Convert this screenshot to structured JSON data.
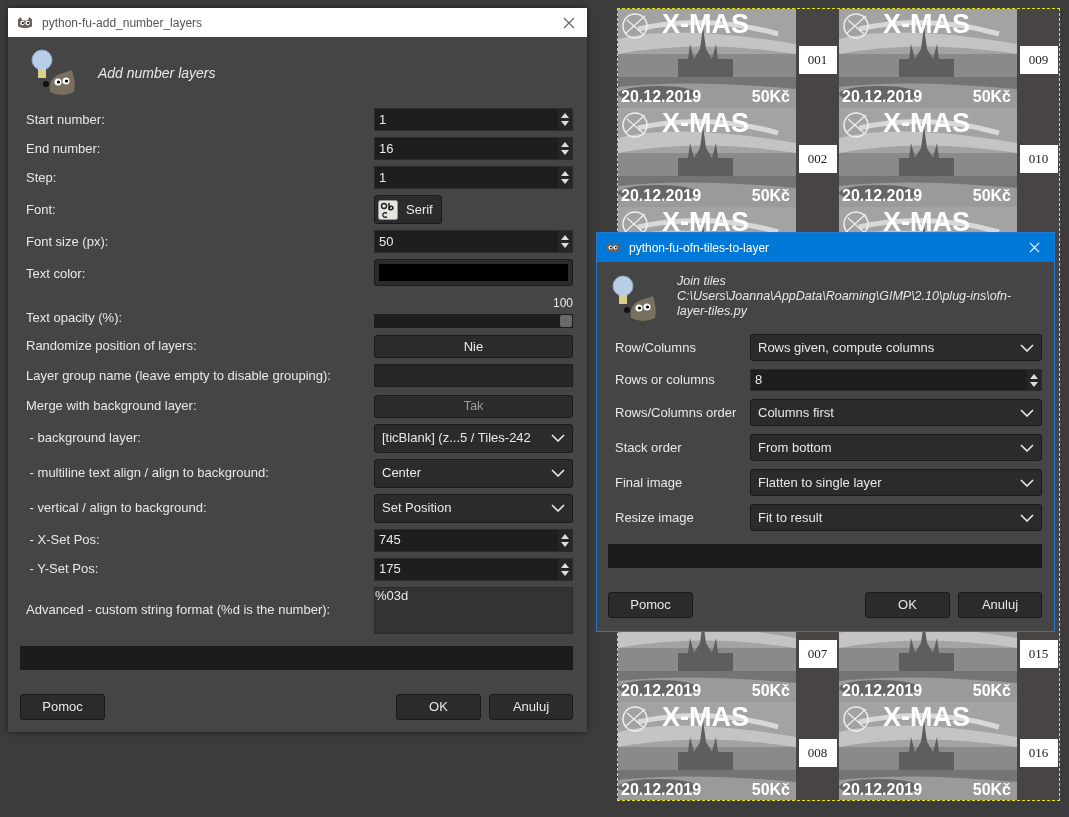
{
  "left_dialog": {
    "title": "python-fu-add_number_layers",
    "heading": "Add number layers",
    "fields": [
      {
        "kind": "spin",
        "label": "Start number:",
        "value": "1"
      },
      {
        "kind": "spin",
        "label": "End number:",
        "value": "16"
      },
      {
        "kind": "spin",
        "label": "Step:",
        "value": "1"
      },
      {
        "kind": "font",
        "label": "Font:",
        "value": "Serif"
      },
      {
        "kind": "spin",
        "label": "Font size (px):",
        "value": "50"
      },
      {
        "kind": "color",
        "label": "Text color:",
        "color": "#000000"
      },
      {
        "kind": "slider",
        "label": "Text opacity (%):",
        "value": "100",
        "level": 1
      },
      {
        "kind": "toggle",
        "label": "Randomize position of layers:",
        "value": "Nie",
        "disabled": false
      },
      {
        "kind": "text",
        "label": "Layer group name (leave empty to disable grouping):"
      },
      {
        "kind": "toggle",
        "label": "Merge with background layer:",
        "value": "Tak",
        "disabled": true
      },
      {
        "kind": "combo",
        "label": " - background layer:",
        "value": "[ticBlank] (z...5 / Tiles-242"
      },
      {
        "kind": "combo",
        "label": " - multiline text align / align to background:",
        "value": "Center"
      },
      {
        "kind": "combo",
        "label": " - vertical / align to background:",
        "value": "Set Position"
      },
      {
        "kind": "spin",
        "label": " - X-Set Pos:",
        "value": "745"
      },
      {
        "kind": "spin",
        "label": " - Y-Set Pos:",
        "value": "175"
      },
      {
        "kind": "textarea",
        "label": "Advanced - custom string format (%d is the number):",
        "value": "%03d"
      }
    ],
    "buttons": [
      "Pomoc",
      "OK",
      "Anuluj"
    ]
  },
  "right_dialog": {
    "title": "python-fu-ofn-tiles-to-layer",
    "heading": "Join tiles",
    "path": "C:\\Users\\Joanna\\AppData\\Roaming\\GIMP\\2.10\\plug-ins\\ofn-layer-tiles.py",
    "fields": [
      {
        "kind": "combo",
        "label": "Row/Columns",
        "value": "Rows given, compute columns"
      },
      {
        "kind": "spin",
        "label": "Rows or columns",
        "value": "8"
      },
      {
        "kind": "combo",
        "label": "Rows/Columns order",
        "value": "Columns first"
      },
      {
        "kind": "combo",
        "label": "Stack order",
        "value": "From bottom"
      },
      {
        "kind": "combo",
        "label": "Final image",
        "value": "Flatten to single layer"
      },
      {
        "kind": "combo",
        "label": "Resize image",
        "value": "Fit to result"
      }
    ],
    "buttons": [
      "Pomoc",
      "OK",
      "Anuluj"
    ]
  },
  "canvas": {
    "top_rows": [
      [
        {
          "title": "X-MAS",
          "date": "20.12.2019",
          "price": "50Kč",
          "number": "001"
        },
        {
          "title": "X-MAS",
          "date": "20.12.2019",
          "price": "50Kč",
          "number": "009"
        }
      ],
      [
        {
          "title": "X-MAS",
          "date": "20.12.2019",
          "price": "50Kč",
          "number": "002"
        },
        {
          "title": "X-MAS",
          "date": "20.12.2019",
          "price": "50Kč",
          "number": "010"
        }
      ],
      [
        {
          "title": "X-MAS"
        },
        {
          "title": "X-MAS"
        }
      ]
    ],
    "bottom_rows": [
      [
        {
          "date": "20.12.2019",
          "price": "50Kč",
          "number": "007"
        },
        {
          "date": "20.12.2019",
          "price": "50Kč",
          "number": "015"
        }
      ],
      [
        {
          "title": "X-MAS",
          "date": "20.12.2019",
          "price": "50Kč",
          "number": "008"
        },
        {
          "title": "X-MAS",
          "date": "20.12.2019",
          "price": "50Kč",
          "number": "016"
        }
      ]
    ]
  }
}
